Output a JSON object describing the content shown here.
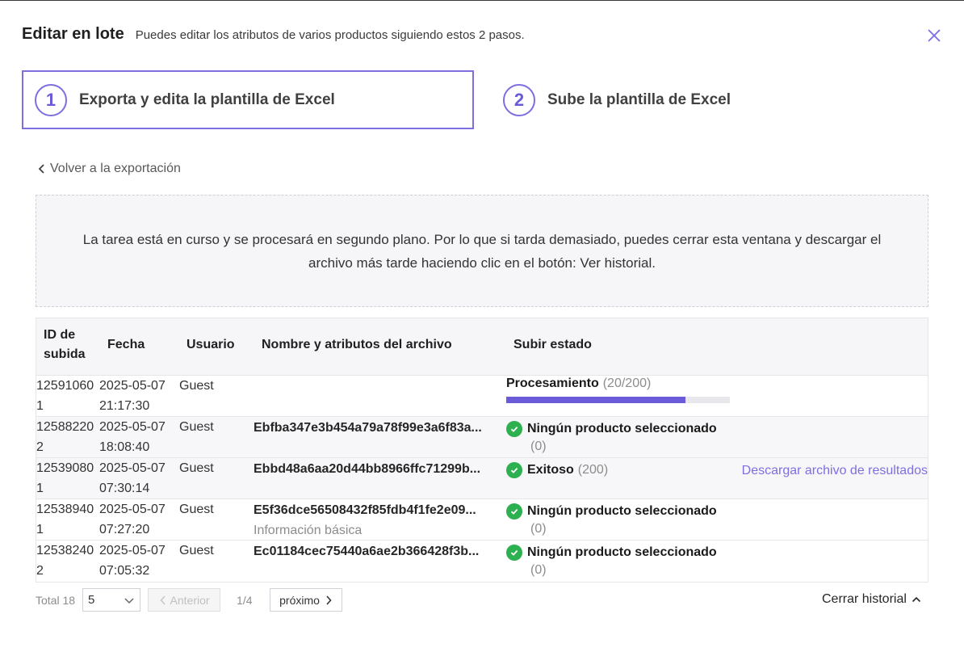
{
  "header": {
    "title": "Editar en lote",
    "subtitle": "Puedes editar los atributos de varios productos siguiendo estos 2 pasos."
  },
  "steps": [
    {
      "number": "1",
      "label": "Exporta y edita la plantilla de Excel",
      "active": true
    },
    {
      "number": "2",
      "label": "Sube la plantilla de Excel",
      "active": false
    }
  ],
  "back_link": "Volver a la exportación",
  "notice": "La tarea está en curso y se procesará en segundo plano. Por lo que si tarda demasiado, puedes cerrar esta ventana y descargar el archivo más tarde haciendo clic en el botón: Ver historial.",
  "table": {
    "headers": {
      "id_line1": "ID de",
      "id_line2": "subida",
      "date": "Fecha",
      "user": "Usuario",
      "file": "Nombre y atributos del archivo",
      "status": "Subir estado"
    },
    "rows": [
      {
        "id_a": "12591060",
        "id_b": "1",
        "date": "2025-05-07",
        "time": "21:17:30",
        "user": "Guest",
        "file": "",
        "file_sub": "",
        "status": "Procesamiento",
        "count": "(20/200)",
        "progress": 0.8,
        "action": ""
      },
      {
        "id_a": "12588220",
        "id_b": "2",
        "date": "2025-05-07",
        "time": "18:08:40",
        "user": "Guest",
        "file": "Ebfba347e3b454a79a78f99e3a6f83a...",
        "file_sub": "",
        "status": "Ningún producto seleccionado",
        "count": "(0)",
        "action": ""
      },
      {
        "id_a": "12539080",
        "id_b": "1",
        "date": "2025-05-07",
        "time": "07:30:14",
        "user": "Guest",
        "file": "Ebbd48a6aa20d44bb8966ffc71299b...",
        "file_sub": "",
        "status": "Exitoso",
        "count": "(200)",
        "action": "Descargar archivo de resultados"
      },
      {
        "id_a": "12538940",
        "id_b": "1",
        "date": "2025-05-07",
        "time": "07:27:20",
        "user": "Guest",
        "file": "E5f36dce56508432f85fdb4f1fe2e09...",
        "file_sub": "Información básica",
        "status": "Ningún producto seleccionado",
        "count": "(0)",
        "action": ""
      },
      {
        "id_a": "12538240",
        "id_b": "2",
        "date": "2025-05-07",
        "time": "07:05:32",
        "user": "Guest",
        "file": "Ec01184cec75440a6ae2b366428f3b...",
        "file_sub": "",
        "status": "Ningún producto seleccionado",
        "count": "(0)",
        "action": ""
      }
    ]
  },
  "pagination": {
    "total": "Total 18",
    "page_size": "5",
    "prev": "Anterior",
    "page_indicator": "1/4",
    "next": "próximo"
  },
  "close_history": "Cerrar historial",
  "colors": {
    "accent": "#7d6fe0",
    "success": "#2db04f",
    "progress": "#6a5bd8"
  }
}
